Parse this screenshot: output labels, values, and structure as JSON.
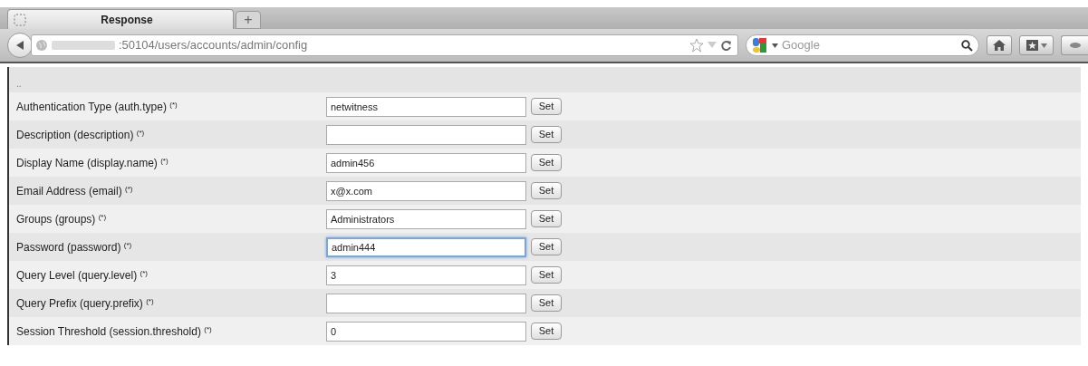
{
  "tabs": [
    {
      "label": "Response",
      "selected": true
    }
  ],
  "new_tab": {
    "label": "+"
  },
  "address_bar": {
    "url": ":50104/users/accounts/admin/config"
  },
  "search": {
    "placeholder": "Google"
  },
  "header": {
    "text": ".."
  },
  "rows": [
    {
      "label": "Authentication Type (auth.type) $^{(*)}$",
      "value": "netwitness",
      "focused": false,
      "button": "Set"
    },
    {
      "label": "Description (description) $^{(*)}$",
      "value": "",
      "focused": false,
      "button": "Set"
    },
    {
      "label": "Display Name (display.name) $^{(*)}$",
      "value": "admin456",
      "focused": false,
      "button": "Set"
    },
    {
      "label": "Email Address (email) $^{(*)}$",
      "value": "x@x.com",
      "focused": false,
      "button": "Set"
    },
    {
      "label": "Groups (groups) $^{(*)}$",
      "value": "Administrators",
      "focused": false,
      "button": "Set"
    },
    {
      "label": "Password (password) $^{(*)}$",
      "value": "admin444",
      "focused": true,
      "button": "Set"
    },
    {
      "label": "Query Level (query.level) $^{(*)}$",
      "value": "3",
      "focused": false,
      "button": "Set"
    },
    {
      "label": "Query Prefix (query.prefix) $^{(*)}$",
      "value": "",
      "focused": false,
      "button": "Set"
    },
    {
      "label": "Session Threshold (session.threshold) $^{(*)}$",
      "value": "0",
      "focused": false,
      "button": "Set"
    }
  ]
}
